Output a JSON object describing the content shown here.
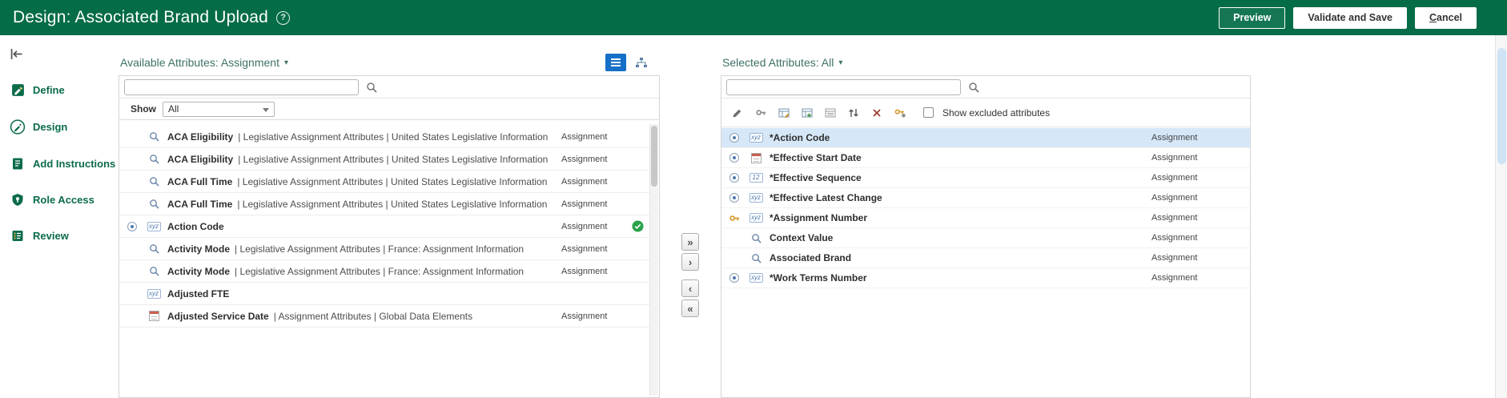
{
  "colors": {
    "header_green": "#046C47",
    "accent_blue": "#1570C7",
    "check_green": "#2BA24C",
    "key_gold": "#D79A2B",
    "selected_row_highlight": "#D6E7F8"
  },
  "header": {
    "title": "Design: Associated Brand Upload",
    "help": "?",
    "buttons": {
      "preview": "Preview",
      "validate_save": "Validate and Save",
      "cancel": "Cancel"
    }
  },
  "sidebar": {
    "items": [
      {
        "label": "Define"
      },
      {
        "label": "Design"
      },
      {
        "label": "Add Instructions"
      },
      {
        "label": "Role Access"
      },
      {
        "label": "Review"
      }
    ]
  },
  "icons": {
    "text_badge": "xyz",
    "sequence_badge": "12"
  },
  "available": {
    "title": "Available Attributes: Assignment",
    "caret": "▾",
    "search_value": "",
    "show_label": "Show",
    "show_value": "All",
    "rows": [
      {
        "name": "ACA Eligibility",
        "path": "| Legislative Assignment Attributes | United States Legislative Information",
        "category": "Assignment"
      },
      {
        "name": "ACA Eligibility",
        "path": "| Legislative Assignment Attributes | United States Legislative Information",
        "category": "Assignment"
      },
      {
        "name": "ACA Full Time",
        "path": "| Legislative Assignment Attributes | United States Legislative Information",
        "category": "Assignment"
      },
      {
        "name": "ACA Full Time",
        "path": "| Legislative Assignment Attributes | United States Legislative Information",
        "category": "Assignment"
      },
      {
        "name": "Action Code",
        "path": "",
        "category": "Assignment"
      },
      {
        "name": "Activity Mode",
        "path": "| Legislative Assignment Attributes | France: Assignment Information",
        "category": "Assignment"
      },
      {
        "name": "Activity Mode",
        "path": "| Legislative Assignment Attributes | France: Assignment Information",
        "category": "Assignment"
      },
      {
        "name": "Adjusted FTE",
        "path": "",
        "category": ""
      },
      {
        "name": "Adjusted Service Date",
        "path": "| Assignment Attributes | Global Data Elements",
        "category": "Assignment"
      }
    ]
  },
  "shuttle": {
    "move_all_right": "»",
    "move_selected_right": "›",
    "move_selected_left": "‹",
    "move_all_left": "«"
  },
  "selected": {
    "title": "Selected Attributes: All",
    "caret": "▾",
    "search_value": "",
    "toolbar": {
      "show_excluded_label": "Show excluded attributes"
    },
    "rows": [
      {
        "name": "*Action Code",
        "category": "Assignment"
      },
      {
        "name": "*Effective Start Date",
        "category": "Assignment"
      },
      {
        "name": "*Effective Sequence",
        "category": "Assignment"
      },
      {
        "name": "*Effective Latest Change",
        "category": "Assignment"
      },
      {
        "name": "*Assignment Number",
        "category": "Assignment"
      },
      {
        "name": "Context Value",
        "category": "Assignment"
      },
      {
        "name": "Associated Brand",
        "category": "Assignment"
      },
      {
        "name": "*Work Terms Number",
        "category": "Assignment"
      }
    ]
  }
}
